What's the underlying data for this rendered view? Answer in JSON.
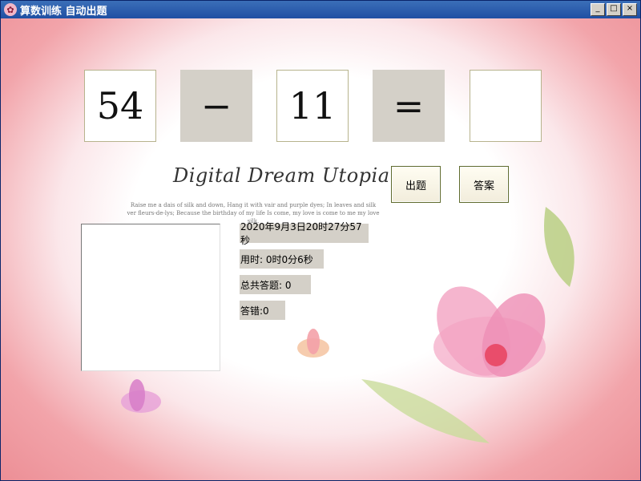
{
  "window": {
    "title": "算数训练  自动出题",
    "minimize": "_",
    "maximize": "□",
    "close": "×"
  },
  "question": {
    "operand1": "54",
    "operator": "−",
    "operand2": "11",
    "equals": "=",
    "answer": ""
  },
  "buttons": {
    "generate": "出题",
    "answer": "答案"
  },
  "logo": {
    "title": "Digital Dream Utopia",
    "line1": "Raise me a dais of silk and down, Hang it with vair and purple dyes; In leaves and silk",
    "line2": "ver fleurs-de-lys; Because the birthday of my life Is come, my love is come to me my love silk."
  },
  "info": {
    "datetime": "2020年9月3日20时27分57秒",
    "elapsed": "用时: 0时0分6秒",
    "total": "总共答题: 0",
    "wrong": "答错:0"
  },
  "colors": {
    "accent": "#f2a4aa",
    "titlebar": "#1f4fa3",
    "op_bg": "#d4d0c8"
  }
}
